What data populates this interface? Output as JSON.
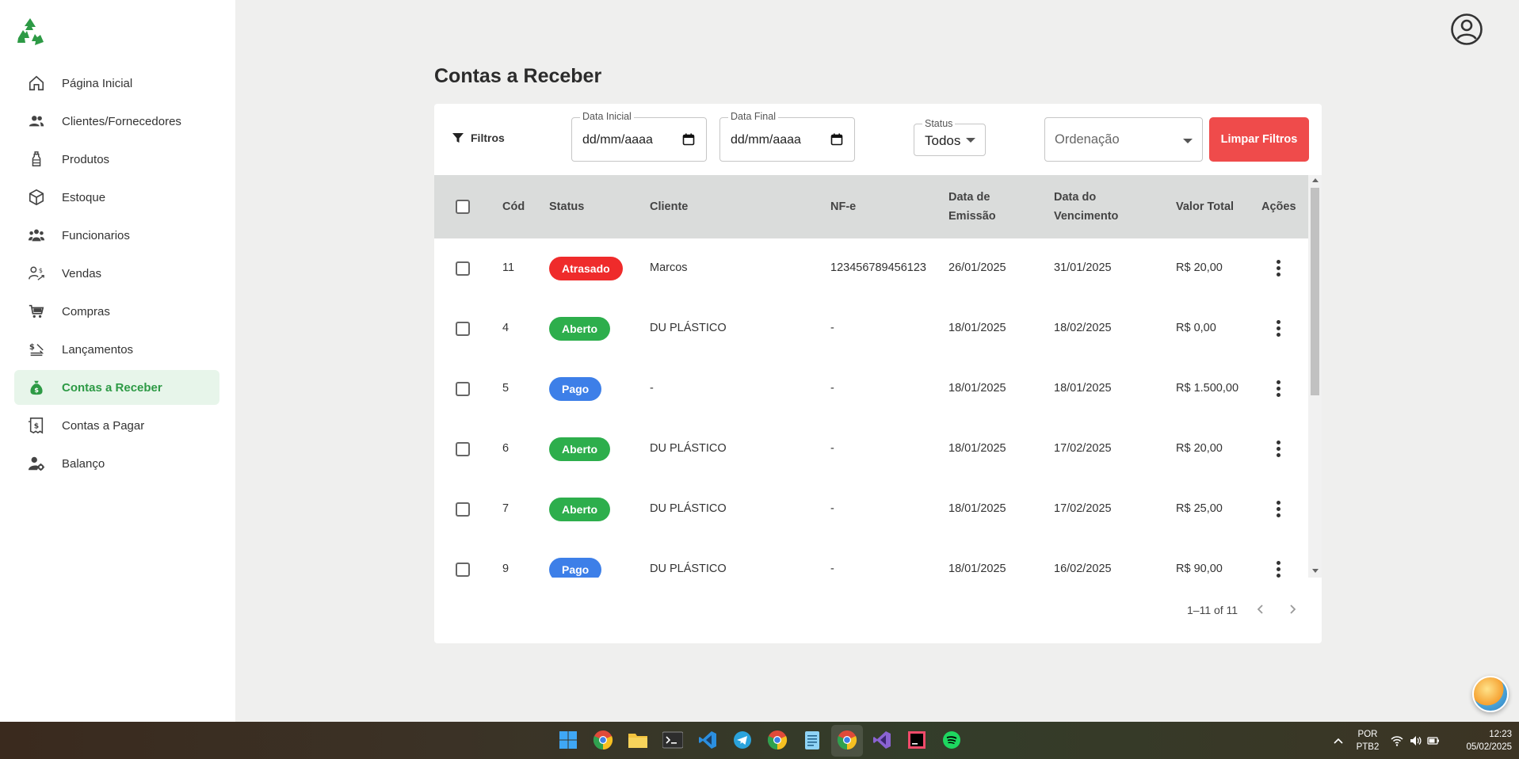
{
  "sidebar": {
    "items": [
      {
        "label": "Página Inicial",
        "icon": "home-icon"
      },
      {
        "label": "Clientes/Fornecedores",
        "icon": "people-icon"
      },
      {
        "label": "Produtos",
        "icon": "bottle-icon"
      },
      {
        "label": "Estoque",
        "icon": "box-icon"
      },
      {
        "label": "Funcionarios",
        "icon": "group-icon"
      },
      {
        "label": "Vendas",
        "icon": "sales-icon"
      },
      {
        "label": "Compras",
        "icon": "cart-icon"
      },
      {
        "label": "Lançamentos",
        "icon": "transactions-icon"
      },
      {
        "label": "Contas a Receber",
        "icon": "money-bag-icon",
        "active": true
      },
      {
        "label": "Contas a Pagar",
        "icon": "bill-icon"
      },
      {
        "label": "Balanço",
        "icon": "user-gear-icon"
      }
    ]
  },
  "page": {
    "title": "Contas a Receber"
  },
  "filters": {
    "label": "Filtros",
    "start_date": {
      "label": "Data Inicial",
      "value": "dd/mm/aaaa"
    },
    "end_date": {
      "label": "Data Final",
      "value": "dd/mm/aaaa"
    },
    "status": {
      "label": "Status",
      "value": "Todos"
    },
    "order": {
      "placeholder": "Ordenação"
    },
    "clear_button": "Limpar Filtros"
  },
  "table": {
    "headers": {
      "code": "Cód",
      "status": "Status",
      "client": "Cliente",
      "nfe": "NF-e",
      "issue_1": "Data de",
      "issue_2": "Emissão",
      "due_1": "Data do",
      "due_2": "Vencimento",
      "total": "Valor Total",
      "actions": "Ações"
    },
    "rows": [
      {
        "code": "11",
        "status": "Atrasado",
        "client": "Marcos",
        "nfe": "123456789456123",
        "issue": "26/01/2025",
        "due": "31/01/2025",
        "total": "R$ 20,00"
      },
      {
        "code": "4",
        "status": "Aberto",
        "client": "DU PLÁSTICO",
        "nfe": "-",
        "issue": "18/01/2025",
        "due": "18/02/2025",
        "total": "R$ 0,00"
      },
      {
        "code": "5",
        "status": "Pago",
        "client": "-",
        "nfe": "-",
        "issue": "18/01/2025",
        "due": "18/01/2025",
        "total": "R$ 1.500,00"
      },
      {
        "code": "6",
        "status": "Aberto",
        "client": "DU PLÁSTICO",
        "nfe": "-",
        "issue": "18/01/2025",
        "due": "17/02/2025",
        "total": "R$ 20,00"
      },
      {
        "code": "7",
        "status": "Aberto",
        "client": "DU PLÁSTICO",
        "nfe": "-",
        "issue": "18/01/2025",
        "due": "17/02/2025",
        "total": "R$ 25,00"
      },
      {
        "code": "9",
        "status": "Pago",
        "client": "DU PLÁSTICO",
        "nfe": "-",
        "issue": "18/01/2025",
        "due": "16/02/2025",
        "total": "R$ 90,00"
      }
    ],
    "pagination": "1–11 of 11"
  },
  "colors": {
    "accent_green": "#2d9a45",
    "danger": "#ef4b4b",
    "badge_late": "#ef2b2b",
    "badge_open": "#2dae4c",
    "badge_paid": "#3d7fe8"
  },
  "taskbar": {
    "lang_1": "POR",
    "lang_2": "PTB2",
    "time": "12:23",
    "date": "05/02/2025"
  }
}
